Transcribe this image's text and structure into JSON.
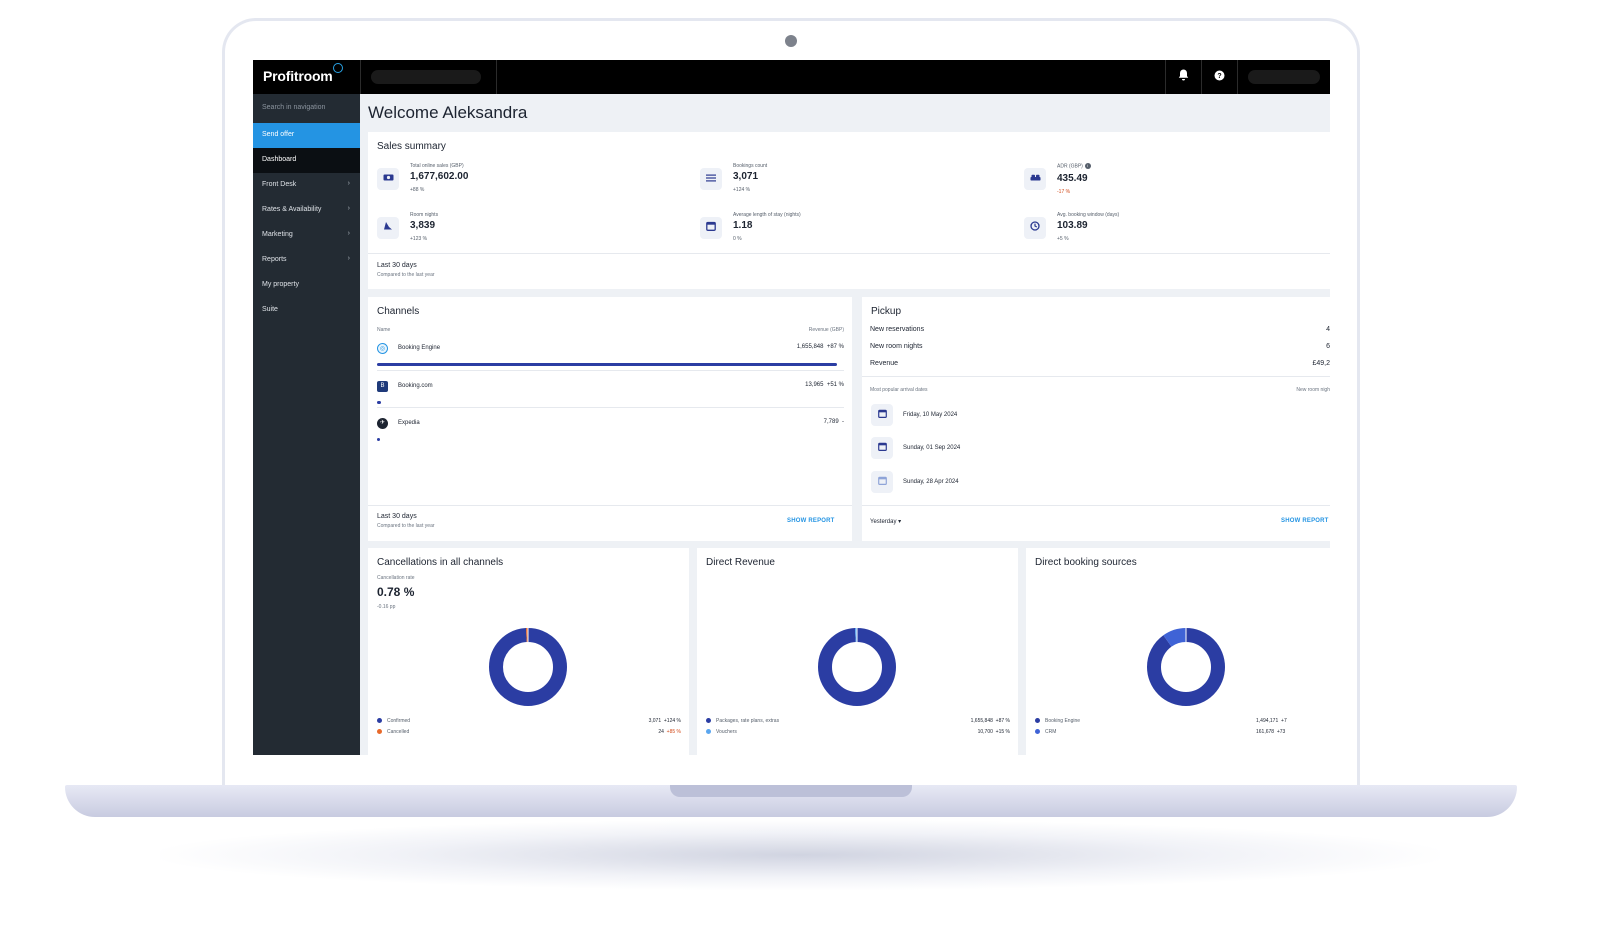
{
  "brand": {
    "logo": "Profitroom"
  },
  "colors": {
    "accent": "#2494e3",
    "navy": "#2b3da3",
    "sidebar": "#232b33",
    "cancelled": "#e8692a",
    "light_blue": "#5aa6ef"
  },
  "topbar": {
    "icons": [
      "bell-icon",
      "help-icon"
    ]
  },
  "sidebar": {
    "search_placeholder": "Search in navigation",
    "send_offer": "Send offer",
    "dashboard": "Dashboard",
    "items": [
      {
        "label": "Front Desk",
        "arrow": "›"
      },
      {
        "label": "Rates & Availability",
        "arrow": "›"
      },
      {
        "label": "Marketing",
        "arrow": "›"
      },
      {
        "label": "Reports",
        "arrow": "›"
      },
      {
        "label": "My property",
        "arrow": ""
      },
      {
        "label": "Suite",
        "arrow": ""
      }
    ]
  },
  "welcome": "Welcome Aleksandra",
  "sales_summary": {
    "title": "Sales summary",
    "kpis": [
      {
        "label": "Total online sales (GBP)",
        "value": "1,677,602.00",
        "delta": "+88 %",
        "icon": "cash-icon"
      },
      {
        "label": "Bookings count",
        "value": "3,071",
        "delta": "+124 %",
        "icon": "list-icon"
      },
      {
        "label": "ADR (GBP)",
        "value": "435.49",
        "delta": "-17 %",
        "icon": "bed-icon"
      },
      {
        "label": "Room nights",
        "value": "3,839",
        "delta": "+123 %",
        "icon": "moon-icon"
      },
      {
        "label": "Average length of stay (nights)",
        "value": "1.18",
        "delta": "0 %",
        "icon": "calendar-icon"
      },
      {
        "label": "Avg. booking window (days)",
        "value": "103.89",
        "delta": "+5 %",
        "icon": "clock-icon"
      }
    ],
    "period": "Last 30 days",
    "period_sub": "Compared to the last year"
  },
  "channels": {
    "title": "Channels",
    "col_name": "Name",
    "col_revenue": "Revenue (GBP)",
    "rows": [
      {
        "name": "Booking Engine",
        "value": "1,655,848",
        "delta": "+87 %",
        "share": 0.985
      },
      {
        "name": "Booking.com",
        "value": "13,965",
        "delta": "+51 %",
        "share": 0.008
      },
      {
        "name": "Expedia",
        "value": "7,789",
        "delta": "-",
        "share": 0.005
      }
    ],
    "period": "Last 30 days",
    "period_sub": "Compared to the last year",
    "show_report": "SHOW REPORT"
  },
  "pickup": {
    "title": "Pickup",
    "rows": [
      {
        "label": "New reservations",
        "value": "4"
      },
      {
        "label": "New room nights",
        "value": "6"
      },
      {
        "label": "Revenue",
        "value": "£49,2"
      }
    ],
    "dates_head": "Most popular arrival dates",
    "dates_col": "New room nigh",
    "dates": [
      "Friday, 10 May 2024",
      "Sunday, 01 Sep 2024",
      "Sunday, 28 Apr 2024"
    ],
    "dropdown": "Yesterday",
    "show_report": "SHOW REPORT"
  },
  "cancellations": {
    "title": "Cancellations in all channels",
    "rate_label": "Cancellation rate",
    "rate": "0.78 %",
    "rate_delta": "-0.16 pp",
    "legend": [
      {
        "label": "Confirmed",
        "value": "3,071",
        "delta": "+124 %",
        "share": 0.99
      },
      {
        "label": "Cancelled",
        "value": "24",
        "delta": "+85 %",
        "share": 0.01
      }
    ]
  },
  "direct_revenue": {
    "title": "Direct Revenue",
    "legend": [
      {
        "label": "Packages, rate plans, extras",
        "value": "1,655,848",
        "delta": "+87 %",
        "share": 0.99
      },
      {
        "label": "Vouchers",
        "value": "10,700",
        "delta": "+15 %",
        "share": 0.01
      }
    ]
  },
  "direct_sources": {
    "title": "Direct booking sources",
    "legend": [
      {
        "label": "Booking Engine",
        "value": "1,494,171",
        "delta": "+7",
        "share": 0.9
      },
      {
        "label": "CRM",
        "value": "161,678",
        "delta": "+73",
        "share": 0.1
      }
    ]
  }
}
